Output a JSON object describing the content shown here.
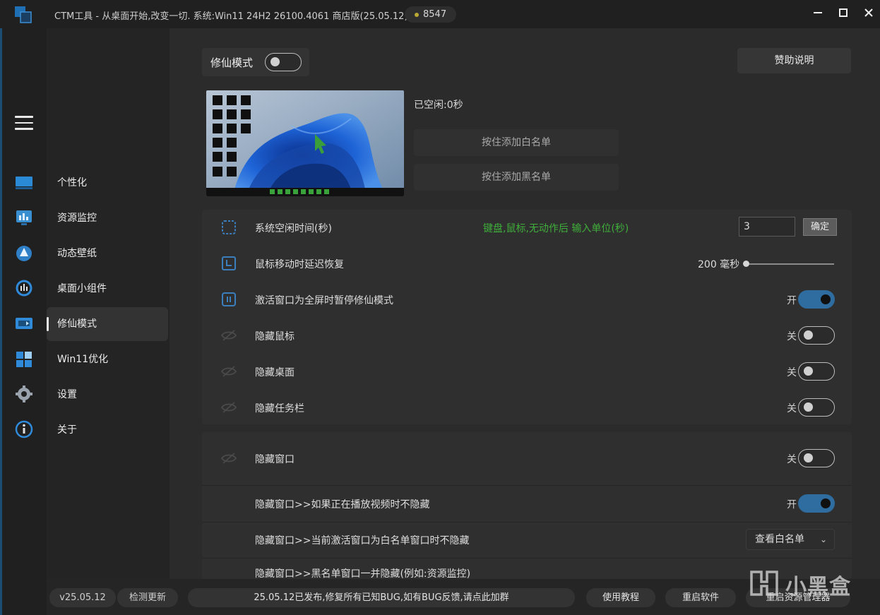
{
  "titlebar": {
    "title": "CTM工具 - 从桌面开始,改变一切. 系统:Win11 24H2 26100.4061 商店版(25.05.12)",
    "coins": "8547"
  },
  "nav": {
    "items": [
      {
        "label": "个性化",
        "icon": "personalize-icon"
      },
      {
        "label": "资源监控",
        "icon": "monitor-icon"
      },
      {
        "label": "动态壁纸",
        "icon": "wallpaper-icon"
      },
      {
        "label": "桌面小组件",
        "icon": "widget-icon"
      },
      {
        "label": "修仙模式",
        "icon": "immortal-mode-icon"
      },
      {
        "label": "Win11优化",
        "icon": "win11-optimize-icon"
      },
      {
        "label": "设置",
        "icon": "gear-icon"
      },
      {
        "label": "关于",
        "icon": "info-icon"
      }
    ],
    "active": "修仙模式"
  },
  "mode": {
    "label": "修仙模式",
    "enabled": false,
    "sponsor_label": "赞助说明"
  },
  "preview": {
    "idle_text": "已空闲:0秒",
    "whitelist_btn": "按住添加白名单",
    "blacklist_btn": "按住添加黑名单"
  },
  "settings": {
    "idle_time": {
      "label": "系统空闲时间(秒)",
      "hint": "键盘,鼠标,无动作后 输入单位(秒)",
      "value": "3",
      "confirm": "确定"
    },
    "mouse_delay": {
      "label": "鼠标移动时延迟恢复",
      "value": "200 毫秒"
    },
    "pause_fullscreen": {
      "label": "激活窗口为全屏时暂停修仙模式",
      "state": "开",
      "on": true
    },
    "hide_mouse": {
      "label": "隐藏鼠标",
      "state": "关",
      "on": false
    },
    "hide_desktop": {
      "label": "隐藏桌面",
      "state": "关",
      "on": false
    },
    "hide_taskbar": {
      "label": "隐藏任务栏",
      "state": "关",
      "on": false
    },
    "hide_window": {
      "label": "隐藏窗口",
      "state": "关",
      "on": false
    },
    "hide_window_video": {
      "label": "隐藏窗口>>如果正在播放视频时不隐藏",
      "state": "开",
      "on": true
    },
    "hide_window_whitelist": {
      "label": "隐藏窗口>>当前激活窗口为白名单窗口时不隐藏",
      "dropdown": "查看白名单"
    },
    "hide_window_blacklist": {
      "label": "隐藏窗口>>黑名单窗口一并隐藏(例如:资源监控)"
    }
  },
  "footer": {
    "version": "v25.05.12",
    "check_update": "检测更新",
    "notice": "25.05.12已发布,修复所有已知BUG,如有BUG反馈,请点此加群",
    "tutorial": "使用教程",
    "restart_app": "重启软件",
    "restart_explorer": "重启资源管理器"
  },
  "watermark": "小黑盒",
  "colors": {
    "accent": "#2f6ca0",
    "hint_green": "#3fae3a",
    "background": "#2b2b2b"
  }
}
